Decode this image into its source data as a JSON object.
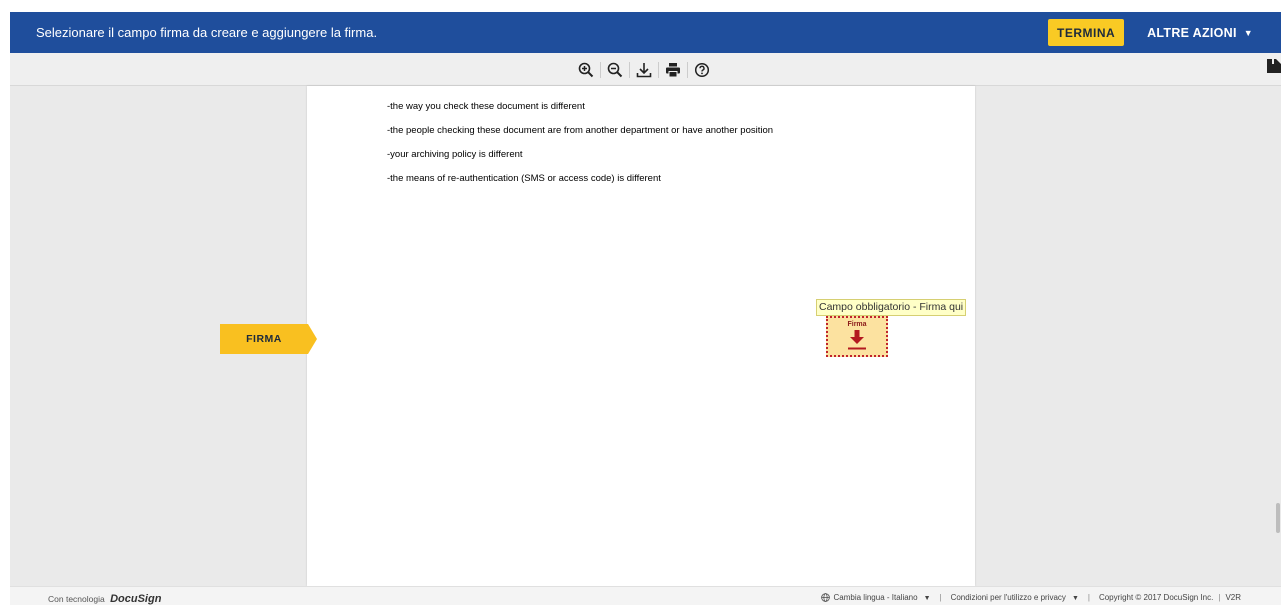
{
  "header": {
    "message": "Selezionare il campo firma da creare e aggiungere la firma.",
    "finish_label": "TERMINA",
    "more_actions_label": "ALTRE AZIONI",
    "colors": {
      "bar": "#1f4e9c",
      "accent": "#f9ca24"
    }
  },
  "toolbar": {
    "icons": [
      "zoom-in-icon",
      "zoom-out-icon",
      "download-icon",
      "print-icon",
      "help-icon"
    ]
  },
  "document": {
    "lines": [
      "-the way you check these document is different",
      "-the people checking these document are from another department or have another position",
      "-your archiving policy is different",
      "-the means of re-authentication (SMS or access code) is different"
    ]
  },
  "signing": {
    "tag_label": "FIRMA",
    "tooltip": "Campo obbligatorio - Firma qui",
    "field_label": "Firma"
  },
  "footer": {
    "powered_prefix": "Con tecnologia",
    "powered_logo": "DocuSign",
    "language": "Cambia lingua - Italiano",
    "terms": "Condizioni per l'utilizzo e privacy",
    "copyright": "Copyright © 2017 DocuSign Inc.",
    "version": "V2R"
  }
}
